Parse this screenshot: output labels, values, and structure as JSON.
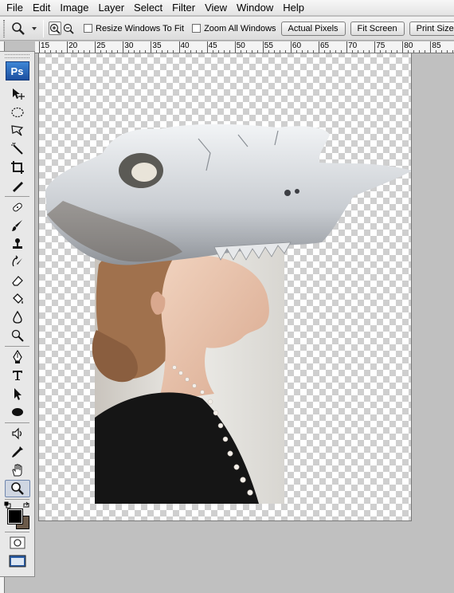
{
  "menu": [
    "File",
    "Edit",
    "Image",
    "Layer",
    "Select",
    "Filter",
    "View",
    "Window",
    "Help"
  ],
  "options": {
    "resize_label": "Resize Windows To Fit",
    "zoom_all_label": "Zoom All Windows",
    "actual_pixels": "Actual Pixels",
    "fit_screen": "Fit Screen",
    "print_size": "Print Size"
  },
  "ruler": {
    "labels": [
      "15",
      "20",
      "25",
      "30",
      "35",
      "40",
      "45",
      "50",
      "55",
      "60",
      "65",
      "70",
      "75",
      "80",
      "85"
    ]
  },
  "toolbox": {
    "logo": "Ps",
    "tools": [
      "move-tool",
      "marquee-tool",
      "lasso-tool",
      "magic-wand-tool",
      "crop-tool",
      "slice-tool",
      "healing-brush-tool",
      "brush-tool",
      "clone-stamp-tool",
      "history-brush-tool",
      "eraser-tool",
      "paint-bucket-tool",
      "blur-tool",
      "dodge-tool",
      "pen-tool",
      "type-tool",
      "path-selection-tool",
      "shape-tool",
      "notes-tool",
      "eyedropper-tool",
      "hand-tool",
      "zoom-tool"
    ],
    "active_tool": "zoom-tool",
    "foreground_color": "#000000",
    "background_color": "#6b5a4a"
  },
  "colors": {
    "checker": "#cfcfcf",
    "workspace": "#c0c0c0"
  }
}
